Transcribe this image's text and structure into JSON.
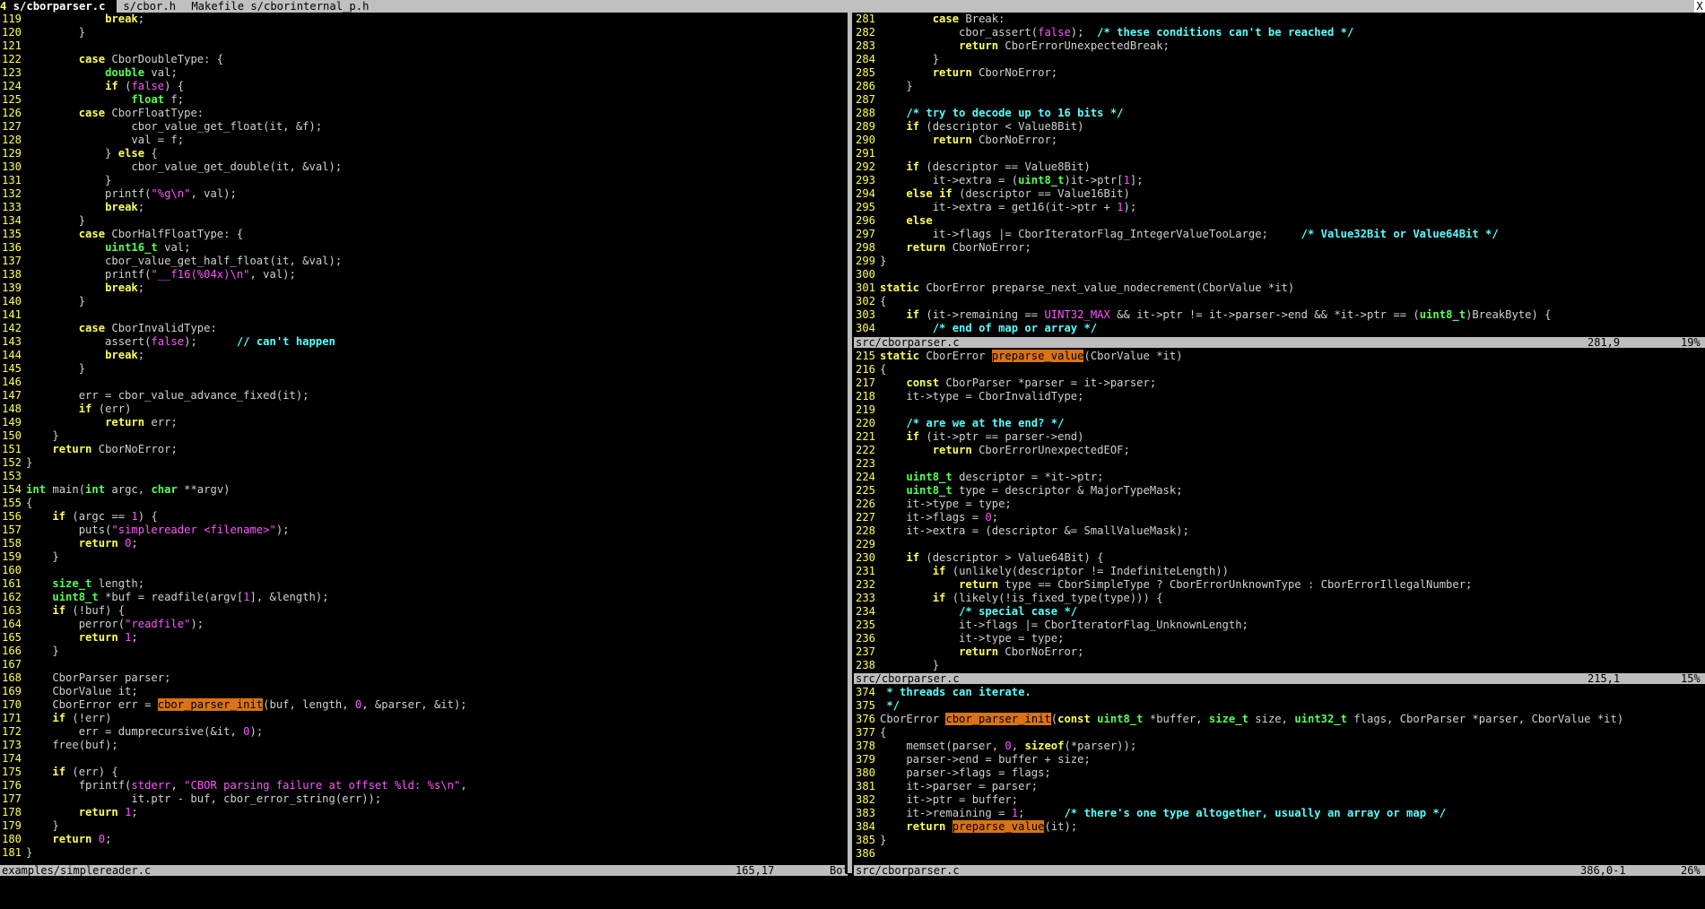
{
  "tabline": {
    "tabs": [
      {
        "num": "4",
        "label": " s/cborparser.c ",
        "selected": true
      },
      {
        "label": " s/cbor.h "
      },
      {
        "label": " Makefile "
      },
      {
        "label": " s/cborinternal_p.h "
      }
    ],
    "close": "X"
  },
  "left": {
    "lines": [
      {
        "n": "119",
        "t": "            break;"
      },
      {
        "n": "120",
        "t": "        }"
      },
      {
        "n": "121",
        "t": ""
      },
      {
        "n": "122",
        "t": "        case CborDoubleType: {"
      },
      {
        "n": "123",
        "t": "            double val;"
      },
      {
        "n": "124",
        "t": "            if (false) {"
      },
      {
        "n": "125",
        "t": "                float f;"
      },
      {
        "n": "126",
        "t": "        case CborFloatType:"
      },
      {
        "n": "127",
        "t": "                cbor_value_get_float(it, &f);"
      },
      {
        "n": "128",
        "t": "                val = f;"
      },
      {
        "n": "129",
        "t": "            } else {"
      },
      {
        "n": "130",
        "t": "                cbor_value_get_double(it, &val);"
      },
      {
        "n": "131",
        "t": "            }"
      },
      {
        "n": "132",
        "t": "            printf(\"%g\\n\", val);"
      },
      {
        "n": "133",
        "t": "            break;"
      },
      {
        "n": "134",
        "t": "        }"
      },
      {
        "n": "135",
        "t": "        case CborHalfFloatType: {"
      },
      {
        "n": "136",
        "t": "            uint16_t val;"
      },
      {
        "n": "137",
        "t": "            cbor_value_get_half_float(it, &val);"
      },
      {
        "n": "138",
        "t": "            printf(\"__f16(%04x)\\n\", val);"
      },
      {
        "n": "139",
        "t": "            break;"
      },
      {
        "n": "140",
        "t": "        }"
      },
      {
        "n": "141",
        "t": ""
      },
      {
        "n": "142",
        "t": "        case CborInvalidType:"
      },
      {
        "n": "143",
        "t": "            assert(false);      // can't happen"
      },
      {
        "n": "144",
        "t": "            break;"
      },
      {
        "n": "145",
        "t": "        }"
      },
      {
        "n": "146",
        "t": ""
      },
      {
        "n": "147",
        "t": "        err = cbor_value_advance_fixed(it);"
      },
      {
        "n": "148",
        "t": "        if (err)"
      },
      {
        "n": "149",
        "t": "            return err;"
      },
      {
        "n": "150",
        "t": "    }"
      },
      {
        "n": "151",
        "t": "    return CborNoError;"
      },
      {
        "n": "152",
        "t": "}"
      },
      {
        "n": "153",
        "t": ""
      },
      {
        "n": "154",
        "t": "int main(int argc, char **argv)"
      },
      {
        "n": "155",
        "t": "{"
      },
      {
        "n": "156",
        "t": "    if (argc == 1) {"
      },
      {
        "n": "157",
        "t": "        puts(\"simplereader <filename>\");"
      },
      {
        "n": "158",
        "t": "        return 0;"
      },
      {
        "n": "159",
        "t": "    }"
      },
      {
        "n": "160",
        "t": ""
      },
      {
        "n": "161",
        "t": "    size_t length;"
      },
      {
        "n": "162",
        "t": "    uint8_t *buf = readfile(argv[1], &length);"
      },
      {
        "n": "163",
        "t": "    if (!buf) {"
      },
      {
        "n": "164",
        "t": "        perror(\"readfile\");"
      },
      {
        "n": "165",
        "t": "        return 1;"
      },
      {
        "n": "166",
        "t": "    }"
      },
      {
        "n": "167",
        "t": ""
      },
      {
        "n": "168",
        "t": "    CborParser parser;"
      },
      {
        "n": "169",
        "t": "    CborValue it;"
      },
      {
        "n": "170",
        "t": "    CborError err = cbor_parser_init(buf, length, 0, &parser, &it);"
      },
      {
        "n": "171",
        "t": "    if (!err)"
      },
      {
        "n": "172",
        "t": "        err = dumprecursive(&it, 0);"
      },
      {
        "n": "173",
        "t": "    free(buf);"
      },
      {
        "n": "174",
        "t": ""
      },
      {
        "n": "175",
        "t": "    if (err) {"
      },
      {
        "n": "176",
        "t": "        fprintf(stderr, \"CBOR parsing failure at offset %ld: %s\\n\","
      },
      {
        "n": "177",
        "t": "                it.ptr - buf, cbor_error_string(err));"
      },
      {
        "n": "178",
        "t": "        return 1;"
      },
      {
        "n": "179",
        "t": "    }"
      },
      {
        "n": "180",
        "t": "    return 0;"
      },
      {
        "n": "181",
        "t": "}"
      }
    ],
    "status": {
      "file": "examples/simplereader.c",
      "pos": "165,17",
      "pct": "Bot"
    }
  },
  "right_top": {
    "lines": [
      {
        "n": "281",
        "t": "        case Break:"
      },
      {
        "n": "282",
        "t": "            cbor_assert(false);  /* these conditions can't be reached */"
      },
      {
        "n": "283",
        "t": "            return CborErrorUnexpectedBreak;"
      },
      {
        "n": "284",
        "t": "        }"
      },
      {
        "n": "285",
        "t": "        return CborNoError;"
      },
      {
        "n": "286",
        "t": "    }"
      },
      {
        "n": "287",
        "t": ""
      },
      {
        "n": "288",
        "t": "    /* try to decode up to 16 bits */"
      },
      {
        "n": "289",
        "t": "    if (descriptor < Value8Bit)"
      },
      {
        "n": "290",
        "t": "        return CborNoError;"
      },
      {
        "n": "291",
        "t": ""
      },
      {
        "n": "292",
        "t": "    if (descriptor == Value8Bit)"
      },
      {
        "n": "293",
        "t": "        it->extra = (uint8_t)it->ptr[1];"
      },
      {
        "n": "294",
        "t": "    else if (descriptor == Value16Bit)"
      },
      {
        "n": "295",
        "t": "        it->extra = get16(it->ptr + 1);"
      },
      {
        "n": "296",
        "t": "    else"
      },
      {
        "n": "297",
        "t": "        it->flags |= CborIteratorFlag_IntegerValueTooLarge;     /* Value32Bit or Value64Bit */"
      },
      {
        "n": "298",
        "t": "    return CborNoError;"
      },
      {
        "n": "299",
        "t": "}"
      },
      {
        "n": "300",
        "t": ""
      },
      {
        "n": "301",
        "t": "static CborError preparse_next_value_nodecrement(CborValue *it)"
      },
      {
        "n": "302",
        "t": "{"
      },
      {
        "n": "303",
        "t": "    if (it->remaining == UINT32_MAX && it->ptr != it->parser->end && *it->ptr == (uint8_t)BreakByte) {"
      },
      {
        "n": "304",
        "t": "        /* end of map or array */"
      }
    ],
    "status": {
      "file": "src/cborparser.c",
      "pos": "281,9",
      "pct": "19%"
    }
  },
  "right_mid": {
    "lines": [
      {
        "n": "215",
        "t": "static CborError preparse_value(CborValue *it)"
      },
      {
        "n": "216",
        "t": "{"
      },
      {
        "n": "217",
        "t": "    const CborParser *parser = it->parser;"
      },
      {
        "n": "218",
        "t": "    it->type = CborInvalidType;"
      },
      {
        "n": "219",
        "t": ""
      },
      {
        "n": "220",
        "t": "    /* are we at the end? */"
      },
      {
        "n": "221",
        "t": "    if (it->ptr == parser->end)"
      },
      {
        "n": "222",
        "t": "        return CborErrorUnexpectedEOF;"
      },
      {
        "n": "223",
        "t": ""
      },
      {
        "n": "224",
        "t": "    uint8_t descriptor = *it->ptr;"
      },
      {
        "n": "225",
        "t": "    uint8_t type = descriptor & MajorTypeMask;"
      },
      {
        "n": "226",
        "t": "    it->type = type;"
      },
      {
        "n": "227",
        "t": "    it->flags = 0;"
      },
      {
        "n": "228",
        "t": "    it->extra = (descriptor &= SmallValueMask);"
      },
      {
        "n": "229",
        "t": ""
      },
      {
        "n": "230",
        "t": "    if (descriptor > Value64Bit) {"
      },
      {
        "n": "231",
        "t": "        if (unlikely(descriptor != IndefiniteLength))"
      },
      {
        "n": "232",
        "t": "            return type == CborSimpleType ? CborErrorUnknownType : CborErrorIllegalNumber;"
      },
      {
        "n": "233",
        "t": "        if (likely(!is_fixed_type(type))) {"
      },
      {
        "n": "234",
        "t": "            /* special case */"
      },
      {
        "n": "235",
        "t": "            it->flags |= CborIteratorFlag_UnknownLength;"
      },
      {
        "n": "236",
        "t": "            it->type = type;"
      },
      {
        "n": "237",
        "t": "            return CborNoError;"
      },
      {
        "n": "238",
        "t": "        }"
      }
    ],
    "status": {
      "file": "src/cborparser.c",
      "pos": "215,1",
      "pct": "15%"
    }
  },
  "right_bot": {
    "lines": [
      {
        "n": "374",
        "t": " * threads can iterate."
      },
      {
        "n": "375",
        "t": " */"
      },
      {
        "n": "376",
        "t": "CborError cbor_parser_init(const uint8_t *buffer, size_t size, uint32_t flags, CborParser *parser, CborValue *it)"
      },
      {
        "n": "377",
        "t": "{"
      },
      {
        "n": "378",
        "t": "    memset(parser, 0, sizeof(*parser));"
      },
      {
        "n": "379",
        "t": "    parser->end = buffer + size;"
      },
      {
        "n": "380",
        "t": "    parser->flags = flags;"
      },
      {
        "n": "381",
        "t": "    it->parser = parser;"
      },
      {
        "n": "382",
        "t": "    it->ptr = buffer;"
      },
      {
        "n": "383",
        "t": "    it->remaining = 1;      /* there's one type altogether, usually an array or map */"
      },
      {
        "n": "384",
        "t": "    return preparse_value(it);"
      },
      {
        "n": "385",
        "t": "}"
      },
      {
        "n": "386",
        "t": ""
      }
    ],
    "status": {
      "file": "src/cborparser.c",
      "pos": "386,0-1",
      "pct": "26%"
    }
  }
}
